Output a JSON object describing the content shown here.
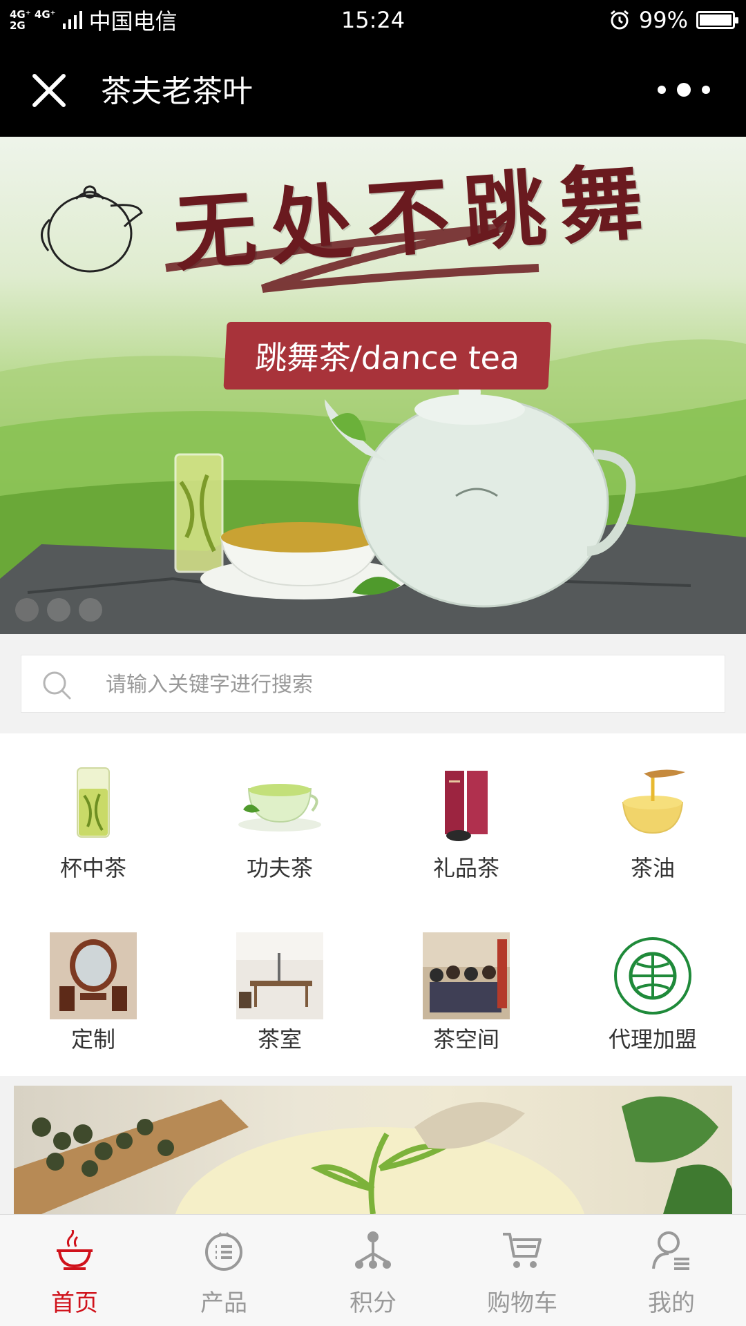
{
  "status_bar": {
    "network_top": "4G⁺ 4G⁺",
    "network_bottom": "2G",
    "carrier": "中国电信",
    "time": "15:24",
    "battery": "99%",
    "battery_level": 0.99
  },
  "header": {
    "title": "茶夫老茶叶"
  },
  "banner": {
    "calligraphy": "无处不跳舞",
    "tag": "跳舞茶/dance tea",
    "slide_count": 3,
    "active_slide": 0
  },
  "search": {
    "placeholder": "请输入关键字进行搜索"
  },
  "categories": [
    {
      "label": "杯中茶",
      "icon": "glass-tea-icon"
    },
    {
      "label": "功夫茶",
      "icon": "tea-cup-icon"
    },
    {
      "label": "礼品茶",
      "icon": "gift-box-icon"
    },
    {
      "label": "茶油",
      "icon": "oil-bowl-icon"
    },
    {
      "label": "定制",
      "icon": "custom-room-image"
    },
    {
      "label": "茶室",
      "icon": "tea-room-image"
    },
    {
      "label": "茶空间",
      "icon": "tea-space-image"
    },
    {
      "label": "代理加盟",
      "icon": "organic-logo-icon"
    }
  ],
  "tabs": [
    {
      "label": "首页",
      "icon": "tea-bowl-icon",
      "active": true
    },
    {
      "label": "产品",
      "icon": "list-icon",
      "active": false
    },
    {
      "label": "积分",
      "icon": "tree-icon",
      "active": false
    },
    {
      "label": "购物车",
      "icon": "cart-icon",
      "active": false
    },
    {
      "label": "我的",
      "icon": "user-icon",
      "active": false
    }
  ],
  "colors": {
    "accent": "#d0121b",
    "banner_tag": "#a8333a",
    "header_bg": "#000000"
  }
}
